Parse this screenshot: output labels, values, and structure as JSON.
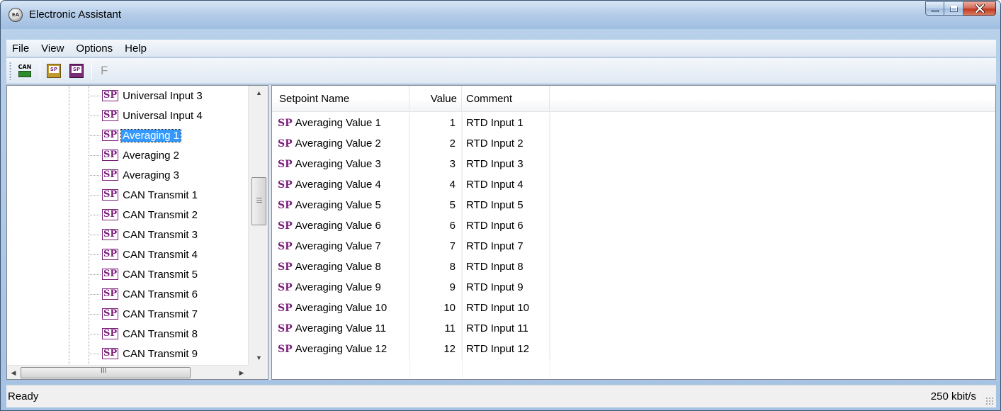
{
  "window": {
    "title": "Electronic Assistant",
    "app_icon_label": "EA"
  },
  "menu": [
    {
      "label": "File"
    },
    {
      "label": "View"
    },
    {
      "label": "Options"
    },
    {
      "label": "Help"
    }
  ],
  "toolbar": {
    "can_icon_text": "CAN",
    "open_icon_text": "SP",
    "save_icon_text": "SP",
    "f_label": "F"
  },
  "tree": {
    "badge": "SP",
    "items": [
      {
        "label": "Universal Input 3",
        "selected": false
      },
      {
        "label": "Universal Input 4",
        "selected": false
      },
      {
        "label": "Averaging 1",
        "selected": true
      },
      {
        "label": "Averaging 2",
        "selected": false
      },
      {
        "label": "Averaging 3",
        "selected": false
      },
      {
        "label": "CAN Transmit 1",
        "selected": false
      },
      {
        "label": "CAN Transmit 2",
        "selected": false
      },
      {
        "label": "CAN Transmit 3",
        "selected": false
      },
      {
        "label": "CAN Transmit 4",
        "selected": false
      },
      {
        "label": "CAN Transmit 5",
        "selected": false
      },
      {
        "label": "CAN Transmit 6",
        "selected": false
      },
      {
        "label": "CAN Transmit 7",
        "selected": false
      },
      {
        "label": "CAN Transmit 8",
        "selected": false
      },
      {
        "label": "CAN Transmit 9",
        "selected": false
      }
    ],
    "hscroll_grip_label": "III"
  },
  "list": {
    "columns": {
      "name": "Setpoint Name",
      "value": "Value",
      "comment": "Comment"
    },
    "badge": "SP",
    "rows": [
      {
        "name": "Averaging Value 1",
        "value": "1",
        "comment": "RTD Input 1"
      },
      {
        "name": "Averaging Value 2",
        "value": "2",
        "comment": "RTD Input 2"
      },
      {
        "name": "Averaging Value 3",
        "value": "3",
        "comment": "RTD Input 3"
      },
      {
        "name": "Averaging Value 4",
        "value": "4",
        "comment": "RTD Input 4"
      },
      {
        "name": "Averaging Value 5",
        "value": "5",
        "comment": "RTD Input 5"
      },
      {
        "name": "Averaging Value 6",
        "value": "6",
        "comment": "RTD Input 6"
      },
      {
        "name": "Averaging Value 7",
        "value": "7",
        "comment": "RTD Input 7"
      },
      {
        "name": "Averaging Value 8",
        "value": "8",
        "comment": "RTD Input 8"
      },
      {
        "name": "Averaging Value 9",
        "value": "9",
        "comment": "RTD Input 9"
      },
      {
        "name": "Averaging Value 10",
        "value": "10",
        "comment": "RTD Input 10"
      },
      {
        "name": "Averaging Value 11",
        "value": "11",
        "comment": "RTD Input 11"
      },
      {
        "name": "Averaging Value 12",
        "value": "12",
        "comment": "RTD Input 12"
      }
    ]
  },
  "status": {
    "left": "Ready",
    "right": "250 kbit/s"
  },
  "colors": {
    "accent": "#3399ff",
    "sp_badge": "#7b1e7b",
    "frame": "#a6c2e3"
  }
}
